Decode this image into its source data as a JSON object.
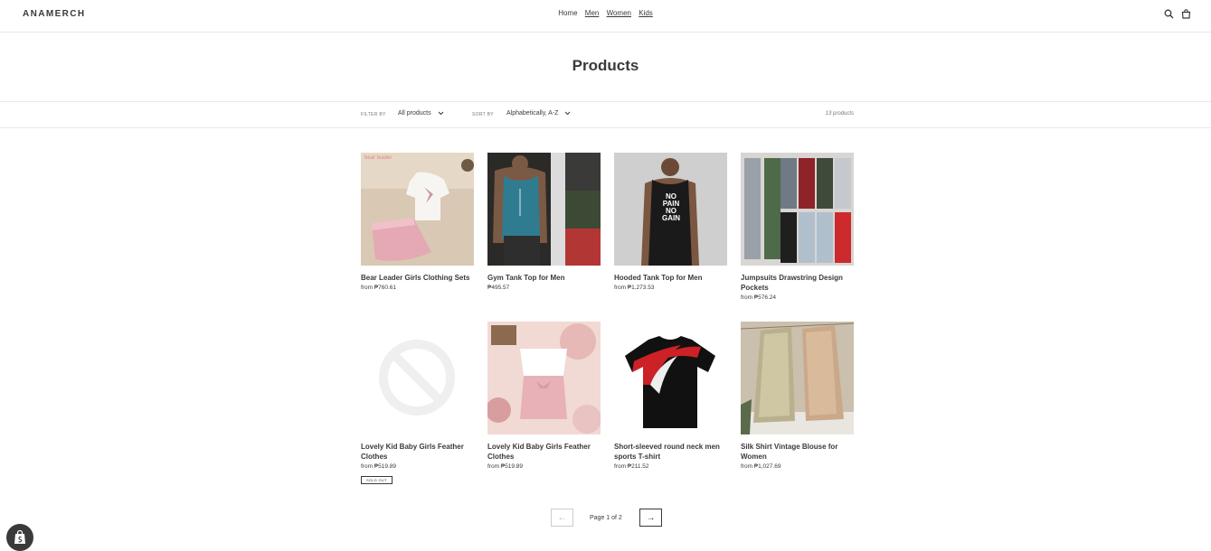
{
  "header": {
    "logo": "ANAMERCH",
    "nav": [
      {
        "label": "Home"
      },
      {
        "label": "Men"
      },
      {
        "label": "Women"
      },
      {
        "label": "Kids"
      }
    ]
  },
  "page": {
    "title": "Products"
  },
  "filters": {
    "filter_label": "FILTER BY",
    "filter_value": "All products",
    "sort_label": "SORT BY",
    "sort_value": "Alphabetically, A-Z",
    "count": "13 products"
  },
  "products": [
    {
      "name": "Bear Leader Girls Clothing Sets",
      "price": "from ₱760.61",
      "image_text": "bear leader"
    },
    {
      "name": "Gym Tank Top for Men",
      "price": "₱495.57"
    },
    {
      "name": "Hooded Tank Top for Men",
      "price": "from ₱1,273.53",
      "image_text": [
        "NO",
        "PAIN",
        "NO",
        "GAIN"
      ]
    },
    {
      "name": "Jumpsuits Drawstring Design Pockets",
      "price": "from ₱576.24"
    },
    {
      "name": "Lovely Kid Baby Girls Feather Clothes",
      "price": "from ₱519.89",
      "badge": "SOLD OUT"
    },
    {
      "name": "Lovely Kid Baby Girls Feather Clothes",
      "price": "from ₱519.89"
    },
    {
      "name": "Short-sleeved round neck men sports T-shirt",
      "price": "from ₱211.52"
    },
    {
      "name": "Silk Shirt Vintage Blouse for Women",
      "price": "from ₱1,027.69"
    }
  ],
  "pagination": {
    "prev": "←",
    "text": "Page 1 of 2",
    "next": "→"
  }
}
